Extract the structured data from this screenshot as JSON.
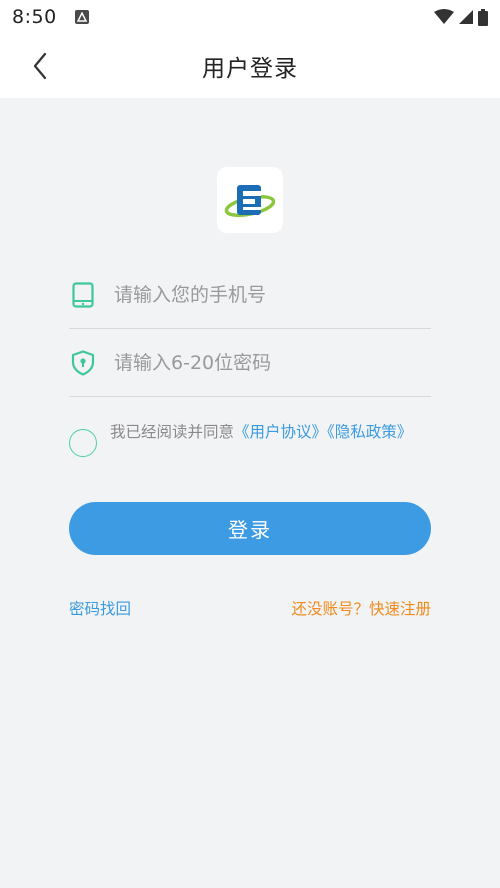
{
  "status_bar": {
    "time": "8:50"
  },
  "header": {
    "title": "用户登录"
  },
  "form": {
    "phone_placeholder": "请输入您的手机号",
    "password_placeholder": "请输入6-20位密码",
    "agreement_prefix": "我已经阅读并同意",
    "user_agreement_link": "《用户协议》",
    "privacy_policy_link": "《隐私政策》",
    "login_label": "登录",
    "forgot_password_label": "密码找回",
    "register_label": "还没账号？快速注册"
  },
  "colors": {
    "accent": "#3c9be3",
    "icon_green": "#3ec79a",
    "register_orange": "#f08a1c"
  },
  "icons": [
    "back-arrow",
    "tablet-phone",
    "shield-lock",
    "app-logo",
    "wifi",
    "signal",
    "battery"
  ]
}
